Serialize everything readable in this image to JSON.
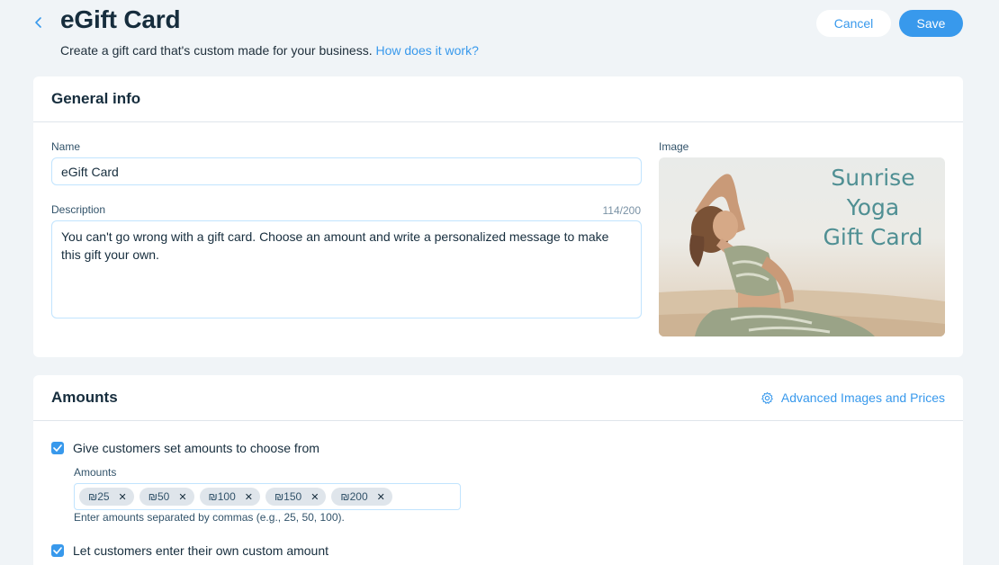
{
  "header": {
    "title": "eGift Card",
    "subtitle": "Create a gift card that's custom made for your business.",
    "help_link": "How does it work?",
    "cancel_label": "Cancel",
    "save_label": "Save"
  },
  "general_info": {
    "title": "General info",
    "name_label": "Name",
    "name_value": "eGift Card",
    "description_label": "Description",
    "description_counter": "114/200",
    "description_value": "You can't go wrong with a gift card. Choose an amount and write a personalized message to make this gift your own.",
    "image_label": "Image",
    "image_caption_lines": [
      "Sunrise",
      "Yoga",
      "Gift Card"
    ]
  },
  "amounts": {
    "title": "Amounts",
    "advanced_link": "Advanced Images and Prices",
    "set_amounts_label": "Give customers set amounts to choose from",
    "set_amounts_checked": true,
    "amounts_label": "Amounts",
    "tags": [
      "₪25",
      "₪50",
      "₪100",
      "₪150",
      "₪200"
    ],
    "helper_text": "Enter amounts separated by commas (e.g., 25, 50, 100).",
    "custom_amount_label": "Let customers enter their own custom amount",
    "custom_amount_checked": true
  },
  "icons": {
    "back": "chevron-left-icon",
    "settings": "gear-icon",
    "check": "check-icon",
    "remove": "close-icon"
  },
  "colors": {
    "accent": "#3899ec",
    "background": "#f0f4f7",
    "text": "#162d3d",
    "image_text": "#4f8f93"
  }
}
